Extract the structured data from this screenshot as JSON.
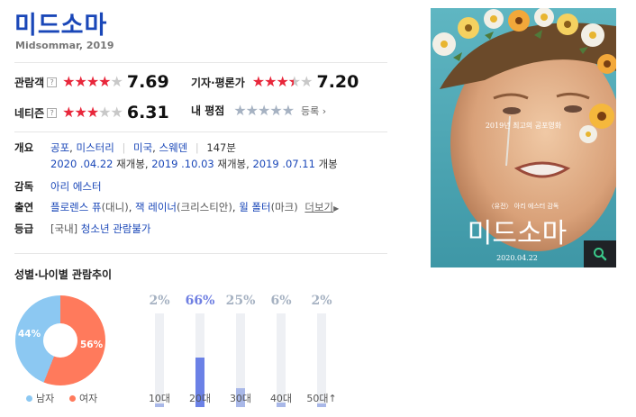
{
  "movie": {
    "title": "미드소마",
    "subtitle": "Midsommar, 2019"
  },
  "ratings": {
    "audience": {
      "label": "관람객",
      "help": "?",
      "stars": 4.0,
      "score": "7.69"
    },
    "critic": {
      "label": "기자·평론가",
      "stars": 3.5,
      "score": "7.20"
    },
    "netizen": {
      "label": "네티즌",
      "help": "?",
      "stars": 3.0,
      "score": "6.31"
    },
    "mine": {
      "label": "내 평점",
      "register": "등록"
    }
  },
  "info": {
    "overview_key": "개요",
    "genres": [
      "공포",
      "미스터리"
    ],
    "countries": [
      "미국",
      "스웨덴"
    ],
    "runtime": "147분",
    "releases": [
      {
        "date": "2020 .04.22",
        "note": "재개봉"
      },
      {
        "date": "2019 .10.03",
        "note": "재개봉"
      },
      {
        "date": "2019 .07.11",
        "note": "개봉"
      }
    ],
    "director_key": "감독",
    "director": "아리 에스터",
    "cast_key": "출연",
    "cast": [
      {
        "name": "플로렌스 퓨",
        "role": "(대니)"
      },
      {
        "name": "잭 레이너",
        "role": "(크리스티안)"
      },
      {
        "name": "윌 폴터",
        "role": "(마크)"
      }
    ],
    "more": "더보기",
    "grade_key": "등급",
    "grade_prefix": "[국내]",
    "grade": "청소년 관람불가"
  },
  "demographics": {
    "title": "성별·나이별 관람추이",
    "gender": {
      "male_pct": 44,
      "female_pct": 56,
      "male_label": "44%",
      "female_label": "56%",
      "male_legend": "남자",
      "female_legend": "여자",
      "male_color": "#8cc8f2",
      "female_color": "#ff7a5c"
    },
    "ages": [
      {
        "label": "10대",
        "pct_label": "2%",
        "pct": 2
      },
      {
        "label": "20대",
        "pct_label": "66%",
        "pct": 66
      },
      {
        "label": "30대",
        "pct_label": "25%",
        "pct": 25
      },
      {
        "label": "40대",
        "pct_label": "6%",
        "pct": 6
      },
      {
        "label": "50대↑",
        "pct_label": "2%",
        "pct": 2
      }
    ]
  },
  "poster": {
    "tagline": "2019년 최고의 공포영화",
    "credit": "〈유전〉 아리 에스터 감독",
    "title": "미드소마",
    "date": "2020.04.22",
    "zoom_icon": "magnifier-icon"
  }
}
